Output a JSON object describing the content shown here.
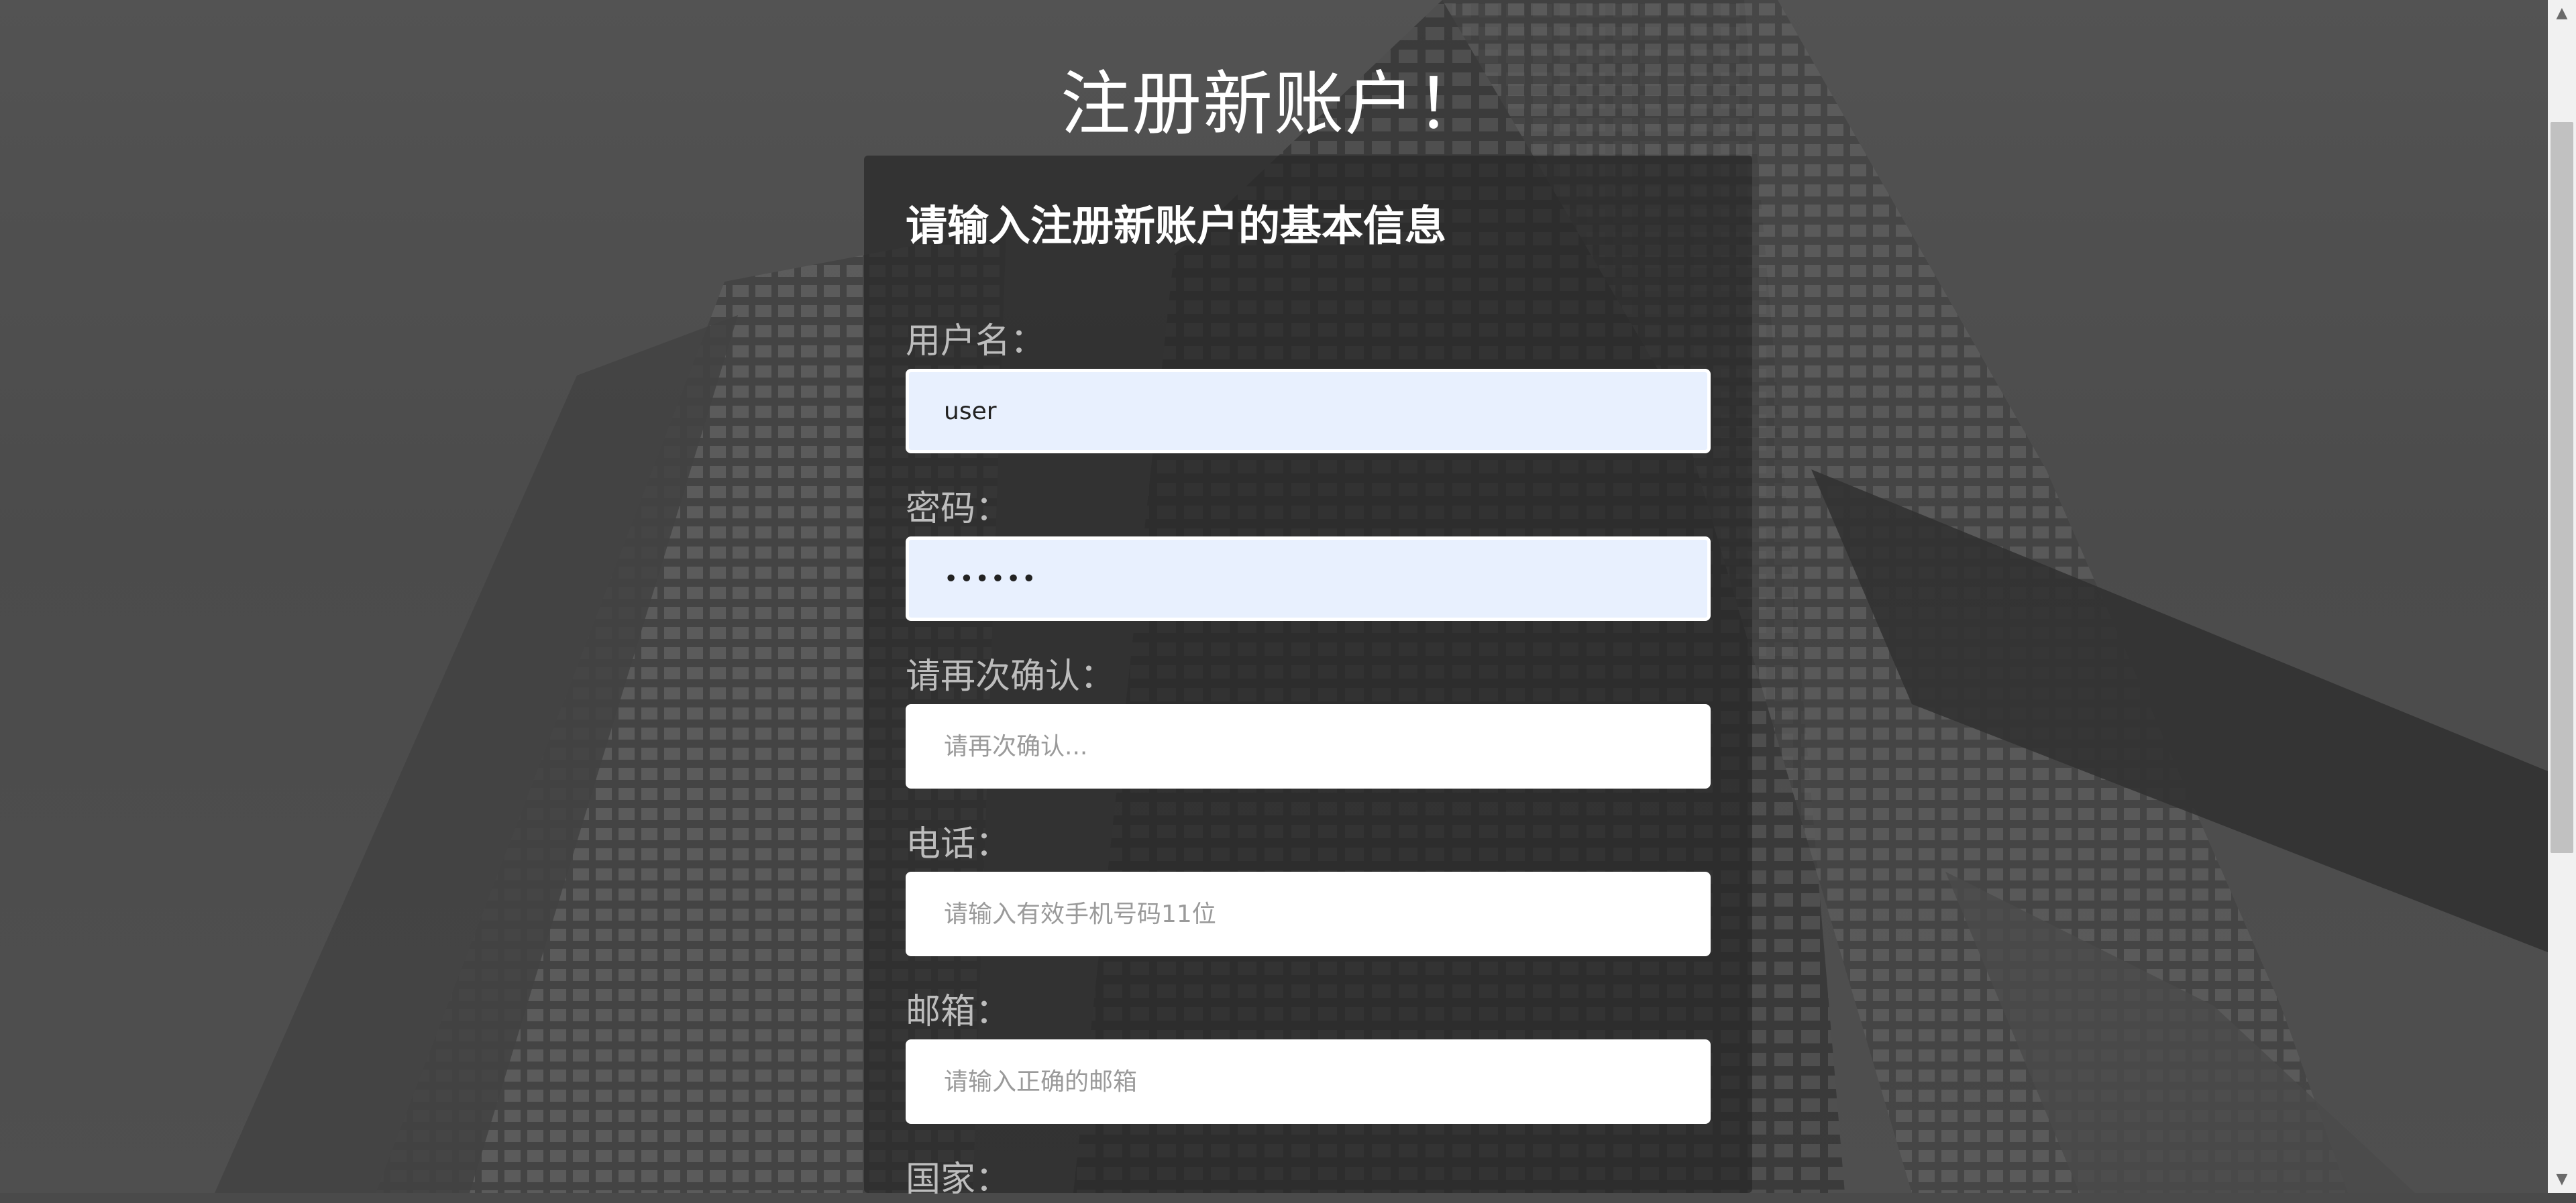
{
  "page": {
    "title": "注册新账户！"
  },
  "form": {
    "heading": "请输入注册新账户的基本信息",
    "fields": [
      {
        "label": "用户名：",
        "value": "user",
        "placeholder": ""
      },
      {
        "label": "密码：",
        "value": "••••••",
        "placeholder": ""
      },
      {
        "label": "请再次确认：",
        "value": "",
        "placeholder": "请再次确认..."
      },
      {
        "label": "电话：",
        "value": "",
        "placeholder": "请输入有效手机号码11位"
      },
      {
        "label": "邮箱：",
        "value": "",
        "placeholder": "请输入正确的邮箱"
      },
      {
        "label": "国家：",
        "value": "",
        "placeholder": ""
      }
    ]
  },
  "scrollbar": {
    "up_icon": "triangle-up-icon",
    "down_icon": "triangle-down-icon"
  }
}
